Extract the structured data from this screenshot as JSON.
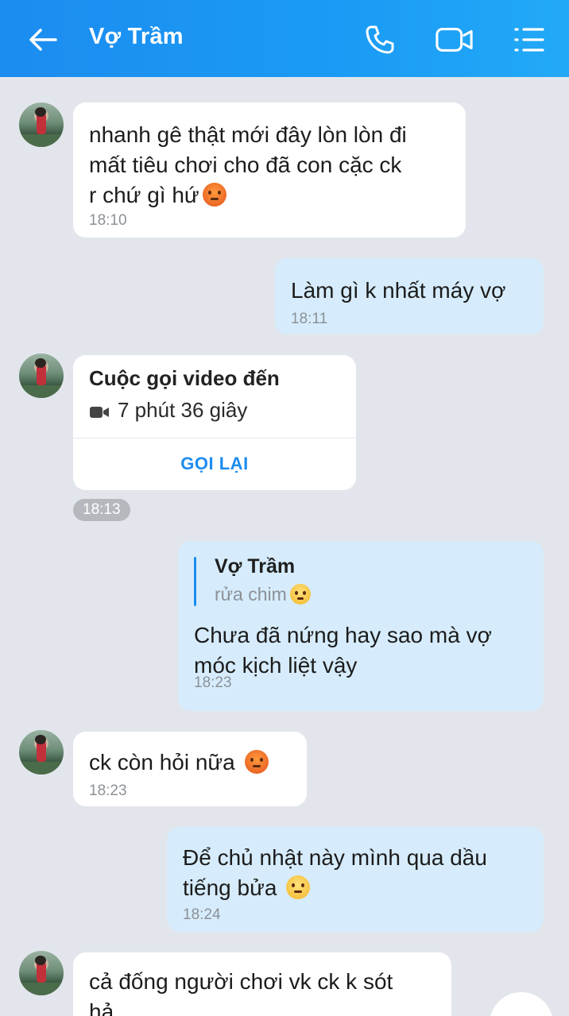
{
  "header": {
    "title": "Vợ Trầm",
    "back_icon": "arrow-left-icon",
    "call_icon": "phone-icon",
    "video_icon": "video-camera-icon",
    "menu_icon": "list-menu-icon"
  },
  "messages": [
    {
      "direction": "in",
      "text": "nhanh gê thật mới đây lòn lòn đi\nmất tiêu chơi cho đã con cặc ck\nr chứ gì hứ",
      "emoji": "angry-face",
      "time": "18:10"
    },
    {
      "direction": "out",
      "text": "Làm gì k nhất máy vợ",
      "time": "18:11"
    },
    {
      "direction": "in",
      "type": "call",
      "call_title": "Cuộc gọi video đến",
      "duration": "7 phút 36 giây",
      "action": "GỌI LẠI",
      "time": "18:13"
    },
    {
      "direction": "out",
      "quote_name": "Vợ Trầm",
      "quote_text": "rửa chim",
      "quote_emoji": "neutral-face",
      "text": "Chưa đã nứng hay sao mà vợ\nmóc kịch liệt vậy",
      "time": "18:23"
    },
    {
      "direction": "in",
      "text": "ck còn hỏi nữa",
      "emoji": "angry-face",
      "time": "18:23"
    },
    {
      "direction": "out",
      "text": "Để chủ nhật này mình qua dầu\ntiếng bửa",
      "emoji": "smirk-face",
      "time": "18:24"
    },
    {
      "direction": "in",
      "text": "cả đống người chơi vk ck k sót\nhả"
    }
  ],
  "colors": {
    "header_start": "#1c8cf0",
    "header_end": "#22a9f6",
    "chat_bg": "#e2e6ec",
    "outgoing_bubble": "#d6ecfc",
    "incoming_bubble": "#ffffff",
    "accent": "#1d8cf0"
  }
}
